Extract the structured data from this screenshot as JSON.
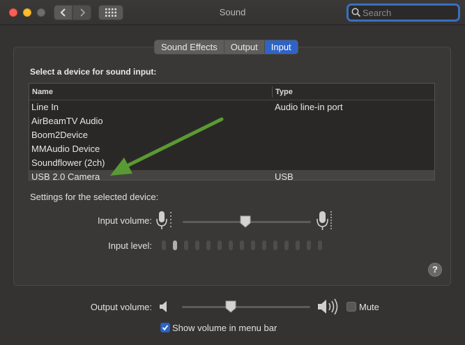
{
  "window": {
    "title": "Sound",
    "search_placeholder": "Search"
  },
  "tabs": [
    {
      "label": "Sound Effects",
      "active": false
    },
    {
      "label": "Output",
      "active": false
    },
    {
      "label": "Input",
      "active": true
    }
  ],
  "input": {
    "heading": "Select a device for sound input:",
    "table": {
      "columns": [
        "Name",
        "Type"
      ],
      "rows": [
        {
          "name": "Line In",
          "type": "Audio line-in port",
          "selected": false
        },
        {
          "name": "AirBeamTV Audio",
          "type": "",
          "selected": false
        },
        {
          "name": "Boom2Device",
          "type": "",
          "selected": false
        },
        {
          "name": "MMAudio Device",
          "type": "",
          "selected": false
        },
        {
          "name": "Soundflower (2ch)",
          "type": "",
          "selected": false
        },
        {
          "name": "USB 2.0 Camera",
          "type": "USB",
          "selected": true
        }
      ]
    },
    "settings_label": "Settings for the selected device:",
    "input_volume_label": "Input volume:",
    "input_volume_fraction": 0.49,
    "input_level_label": "Input level:",
    "input_level_segments": 15,
    "input_level_active": 2
  },
  "output": {
    "volume_label": "Output volume:",
    "volume_fraction": 0.38,
    "mute_label": "Mute",
    "mute_checked": false,
    "show_in_menu_bar_label": "Show volume in menu bar",
    "show_in_menu_bar_checked": true
  },
  "colors": {
    "accent": "#2f64c7",
    "annotation_arrow": "#5a9a34",
    "window_bg": "#353331"
  }
}
